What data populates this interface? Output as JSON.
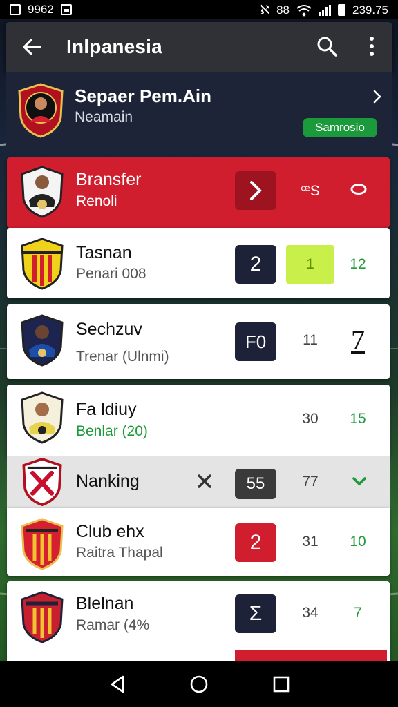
{
  "status_bar": {
    "left_text": "9962",
    "right_text": "88",
    "time": "239.75"
  },
  "app_bar": {
    "title": "Inlpanesia"
  },
  "profile": {
    "name": "Sepaer Pem.Ain",
    "subtitle": "Neamain",
    "badge": "Samrosio"
  },
  "rows": [
    {
      "name": "Bransfer",
      "sub": "Renoli",
      "c2": "ꟹS",
      "highlight": true
    },
    {
      "name": "Tasnan",
      "sub": "Penari 008",
      "box": "2",
      "c2": "1",
      "c3": "12"
    },
    {
      "name": "Sechzuv",
      "sub": "Trenar (Ulnmi)",
      "box": "F0",
      "c2": "11",
      "c3": "7"
    },
    {
      "name": "Fa ldiuy",
      "sub": "Benlar (20)",
      "c2": "30",
      "c3": "15"
    },
    {
      "name": "Nanking",
      "box": "55",
      "c2": "77"
    },
    {
      "name": "Club ehx",
      "sub": "Raitra Thapal",
      "box": "2",
      "c2": "31",
      "c3": "10"
    },
    {
      "name": "Blelnan",
      "sub": "Ramar (4%",
      "box": "Σ",
      "c2": "34",
      "c3": "7"
    }
  ],
  "colors": {
    "red": "#d01e2e",
    "navy": "#1e2238",
    "lime": "#c8ef4a",
    "green": "#1e9a3a"
  },
  "icons": [
    "back-arrow-icon",
    "search-icon",
    "more-vert-icon",
    "chevron-right-icon",
    "close-icon",
    "chevron-down-icon",
    "back-nav-icon",
    "home-nav-icon",
    "recents-nav-icon"
  ]
}
